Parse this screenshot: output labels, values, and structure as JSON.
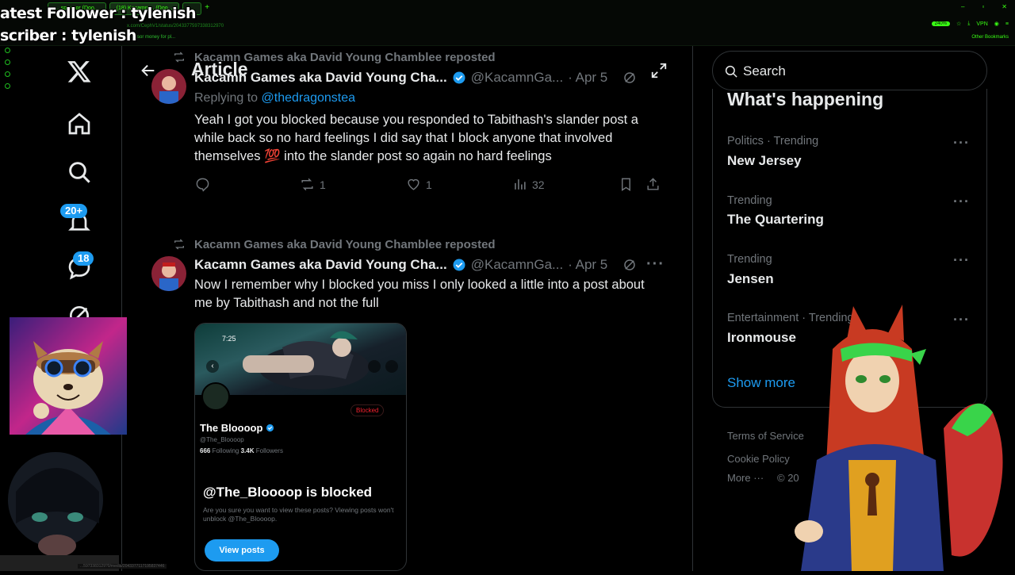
{
  "overlay": {
    "follower_line": "atest Follower : tylenish",
    "subscriber_line": "scriber : tylenish"
  },
  "browser": {
    "tabs": [
      "... sponsor (Doo...",
      "(18) Kacamn ... (Doo...",
      "..."
    ],
    "url": "x.com/CephV1/status/2043377597338312970",
    "bookmarks_text": "sponsor money for pl...",
    "zoom": "240%",
    "vpn_label": "VPN",
    "other_bookmarks": "Other Bookmarks",
    "status_url": "...5973383129?0/media/2043377117195837446"
  },
  "nav": {
    "notifications_badge": "20+",
    "messages_badge": "18"
  },
  "header": {
    "title": "Article"
  },
  "tweets": [
    {
      "repost_label": "Kacamn Games aka David Young Chamblee reposted",
      "author_name": "Kacamn Games aka David Young Cha...",
      "handle": "@KacamnGa...",
      "date": "· Apr 5",
      "reply_prefix": "Replying to ",
      "reply_to": "@thedragonstea",
      "text": "Yeah I got you blocked because you responded to Tabithash's slander post a while back so no hard feelings I did say that I block anyone that involved themselves 💯 into the slander post so again no hard feelings",
      "retweets": "1",
      "likes": "1",
      "views": "32"
    },
    {
      "repost_label": "Kacamn Games aka David Young Chamblee reposted",
      "author_name": "Kacamn Games aka David Young Cha...",
      "handle": "@KacamnGa...",
      "date": "· Apr 5",
      "text": "Now I remember why I blocked you miss I only looked a little into a post about me by Tabithash and not the full"
    }
  ],
  "embed": {
    "time": "7:25",
    "blocked_pill": "Blocked",
    "profile_name": "The Bloooop",
    "profile_handle": "@The_Bloooop",
    "following": "666",
    "following_label": " Following  ",
    "followers": "3.4K",
    "followers_label": " Followers",
    "heading": "@The_Bloooop is blocked",
    "subtext": "Are you sure you want to view these posts? Viewing posts won't unblock @The_Bloooop.",
    "button": "View posts"
  },
  "sidebar_right": {
    "search_placeholder": "Search",
    "panel_title": "What's happening",
    "trends": [
      {
        "meta": "Politics · Trending",
        "name": "New Jersey"
      },
      {
        "meta": "Trending",
        "name": "The Quartering"
      },
      {
        "meta": "Trending",
        "name": "Jensen"
      },
      {
        "meta": "Entertainment · Trending",
        "name": "Ironmouse"
      }
    ],
    "show_more": "Show more",
    "footer": [
      "Terms of Service",
      "Cookie Policy",
      "More ···",
      "© 20"
    ]
  },
  "colors": {
    "accent": "#1d9bf0",
    "muted": "#71767b",
    "text": "#e7e9ea",
    "border": "#2f3336",
    "chrome_green": "#39ff14"
  }
}
